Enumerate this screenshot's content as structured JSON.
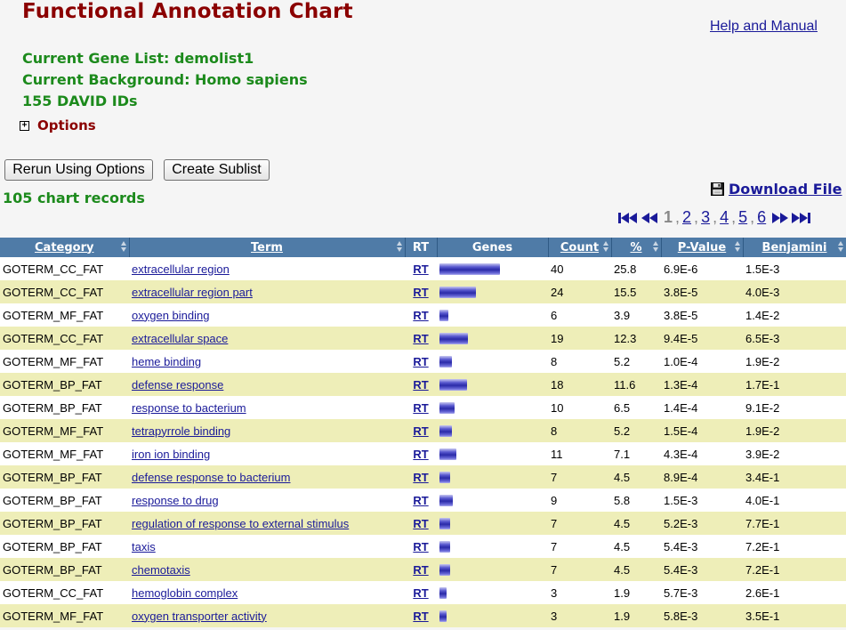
{
  "header": {
    "title": "Functional Annotation Chart",
    "help_link": "Help and Manual",
    "gene_list": "Current Gene List: demolist1",
    "background": "Current Background: Homo sapiens",
    "david_ids": "155 DAVID IDs",
    "options_label": "Options"
  },
  "toolbar": {
    "rerun_label": "Rerun Using Options",
    "sublist_label": "Create Sublist",
    "chart_records": "105 chart records",
    "download_label": "Download File"
  },
  "pager": {
    "current": "1",
    "pages": [
      "2",
      "3",
      "4",
      "5",
      "6"
    ]
  },
  "table": {
    "columns": {
      "category": "Category",
      "term": "Term",
      "rt": "RT",
      "genes": "Genes",
      "count": "Count",
      "percent": "%",
      "pvalue": "P-Value",
      "benjamini": "Benjamini"
    },
    "rows": [
      {
        "category": "GOTERM_CC_FAT",
        "term": "extracellular region",
        "rt": "RT",
        "count": "40",
        "percent": "25.8",
        "pvalue": "6.9E-6",
        "benjamini": "1.5E-3"
      },
      {
        "category": "GOTERM_CC_FAT",
        "term": "extracellular region part",
        "rt": "RT",
        "count": "24",
        "percent": "15.5",
        "pvalue": "3.8E-5",
        "benjamini": "4.0E-3"
      },
      {
        "category": "GOTERM_MF_FAT",
        "term": "oxygen binding",
        "rt": "RT",
        "count": "6",
        "percent": "3.9",
        "pvalue": "3.8E-5",
        "benjamini": "1.4E-2"
      },
      {
        "category": "GOTERM_CC_FAT",
        "term": "extracellular space",
        "rt": "RT",
        "count": "19",
        "percent": "12.3",
        "pvalue": "9.4E-5",
        "benjamini": "6.5E-3"
      },
      {
        "category": "GOTERM_MF_FAT",
        "term": "heme binding",
        "rt": "RT",
        "count": "8",
        "percent": "5.2",
        "pvalue": "1.0E-4",
        "benjamini": "1.9E-2"
      },
      {
        "category": "GOTERM_BP_FAT",
        "term": "defense response",
        "rt": "RT",
        "count": "18",
        "percent": "11.6",
        "pvalue": "1.3E-4",
        "benjamini": "1.7E-1"
      },
      {
        "category": "GOTERM_BP_FAT",
        "term": "response to bacterium",
        "rt": "RT",
        "count": "10",
        "percent": "6.5",
        "pvalue": "1.4E-4",
        "benjamini": "9.1E-2"
      },
      {
        "category": "GOTERM_MF_FAT",
        "term": "tetrapyrrole binding",
        "rt": "RT",
        "count": "8",
        "percent": "5.2",
        "pvalue": "1.5E-4",
        "benjamini": "1.9E-2"
      },
      {
        "category": "GOTERM_MF_FAT",
        "term": "iron ion binding",
        "rt": "RT",
        "count": "11",
        "percent": "7.1",
        "pvalue": "4.3E-4",
        "benjamini": "3.9E-2"
      },
      {
        "category": "GOTERM_BP_FAT",
        "term": "defense response to bacterium",
        "rt": "RT",
        "count": "7",
        "percent": "4.5",
        "pvalue": "8.9E-4",
        "benjamini": "3.4E-1"
      },
      {
        "category": "GOTERM_BP_FAT",
        "term": "response to drug",
        "rt": "RT",
        "count": "9",
        "percent": "5.8",
        "pvalue": "1.5E-3",
        "benjamini": "4.0E-1"
      },
      {
        "category": "GOTERM_BP_FAT",
        "term": "regulation of response to external stimulus",
        "rt": "RT",
        "count": "7",
        "percent": "4.5",
        "pvalue": "5.2E-3",
        "benjamini": "7.7E-1"
      },
      {
        "category": "GOTERM_BP_FAT",
        "term": "taxis",
        "rt": "RT",
        "count": "7",
        "percent": "4.5",
        "pvalue": "5.4E-3",
        "benjamini": "7.2E-1"
      },
      {
        "category": "GOTERM_BP_FAT",
        "term": "chemotaxis",
        "rt": "RT",
        "count": "7",
        "percent": "4.5",
        "pvalue": "5.4E-3",
        "benjamini": "7.2E-1"
      },
      {
        "category": "GOTERM_CC_FAT",
        "term": "hemoglobin complex",
        "rt": "RT",
        "count": "3",
        "percent": "1.9",
        "pvalue": "5.7E-3",
        "benjamini": "2.6E-1"
      },
      {
        "category": "GOTERM_MF_FAT",
        "term": "oxygen transporter activity",
        "rt": "RT",
        "count": "3",
        "percent": "1.9",
        "pvalue": "5.8E-3",
        "benjamini": "3.5E-1"
      }
    ]
  },
  "colors": {
    "title": "#8b0000",
    "info_green": "#1c8a1c",
    "header_blue": "#4f7ba7",
    "row_alt": "#eeeeb8",
    "link": "#1a1a99"
  }
}
